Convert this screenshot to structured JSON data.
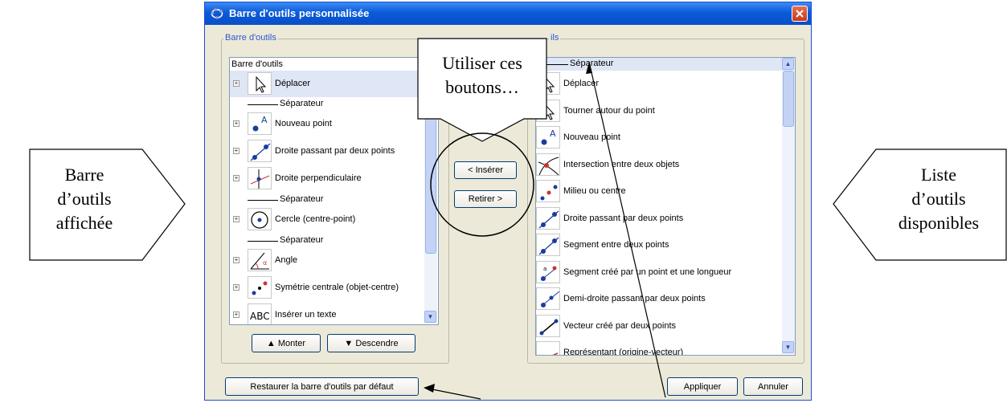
{
  "window": {
    "title": "Barre d'outils personnalisée",
    "left_group_label": "Barre d'outils",
    "right_group_label_partial": "ils"
  },
  "toolbar_list": {
    "header": "Barre d'outils",
    "items": [
      {
        "label": "Déplacer",
        "icon": "arrow-cursor-icon",
        "selected": true
      },
      {
        "label": "Séparateur",
        "separator": true
      },
      {
        "label": "Nouveau point",
        "icon": "new-point-icon"
      },
      {
        "label": "Droite passant par deux points",
        "icon": "line-two-points-icon"
      },
      {
        "label": "Droite perpendiculaire",
        "icon": "perpendicular-line-icon"
      },
      {
        "label": "Séparateur",
        "separator": true
      },
      {
        "label": "Cercle (centre-point)",
        "icon": "circle-center-point-icon"
      },
      {
        "label": "Séparateur",
        "separator": true
      },
      {
        "label": "Angle",
        "icon": "angle-icon"
      },
      {
        "label": "Symétrie centrale (objet-centre)",
        "icon": "point-reflection-icon"
      },
      {
        "label": "Insérer un texte",
        "icon": "insert-text-icon",
        "icon_text": "ABC"
      }
    ]
  },
  "available_list": {
    "items": [
      {
        "label": "Séparateur",
        "separator": true,
        "selected": true
      },
      {
        "label": "Déplacer",
        "icon": "arrow-cursor-icon"
      },
      {
        "label": "Tourner autour du point",
        "icon": "rotate-around-point-icon"
      },
      {
        "label": "Nouveau point",
        "icon": "new-point-icon"
      },
      {
        "label": "Intersection entre deux objets",
        "icon": "intersection-icon"
      },
      {
        "label": "Milieu ou centre",
        "icon": "midpoint-icon"
      },
      {
        "label": "Droite passant par deux points",
        "icon": "line-two-points-icon"
      },
      {
        "label": "Segment entre deux points",
        "icon": "segment-icon"
      },
      {
        "label": "Segment créé par un point et une longueur",
        "icon": "segment-fixed-length-icon"
      },
      {
        "label": "Demi-droite passant par deux points",
        "icon": "ray-icon"
      },
      {
        "label": "Vecteur créé par deux points",
        "icon": "vector-icon"
      },
      {
        "label": "Représentant (origine-vecteur)",
        "icon": "vector-from-point-icon"
      }
    ]
  },
  "buttons": {
    "insert": "< Insérer",
    "remove": "Retirer >",
    "up": "Monter",
    "down": "Descendre",
    "restore": "Restaurer la barre d'outils par défaut",
    "apply": "Appliquer",
    "cancel": "Annuler"
  },
  "callouts": {
    "left_line1": "Barre",
    "left_line2": "d’outils",
    "left_line3": "affichée",
    "right_line1": "Liste",
    "right_line2": "d’outils",
    "right_line3": "disponibles",
    "center_line1": "Utiliser ces",
    "center_line2": "boutons…"
  },
  "colors": {
    "title_bar": "#0b5ad9",
    "group_label": "#2a58d0",
    "selection": "#dfe6f5"
  }
}
